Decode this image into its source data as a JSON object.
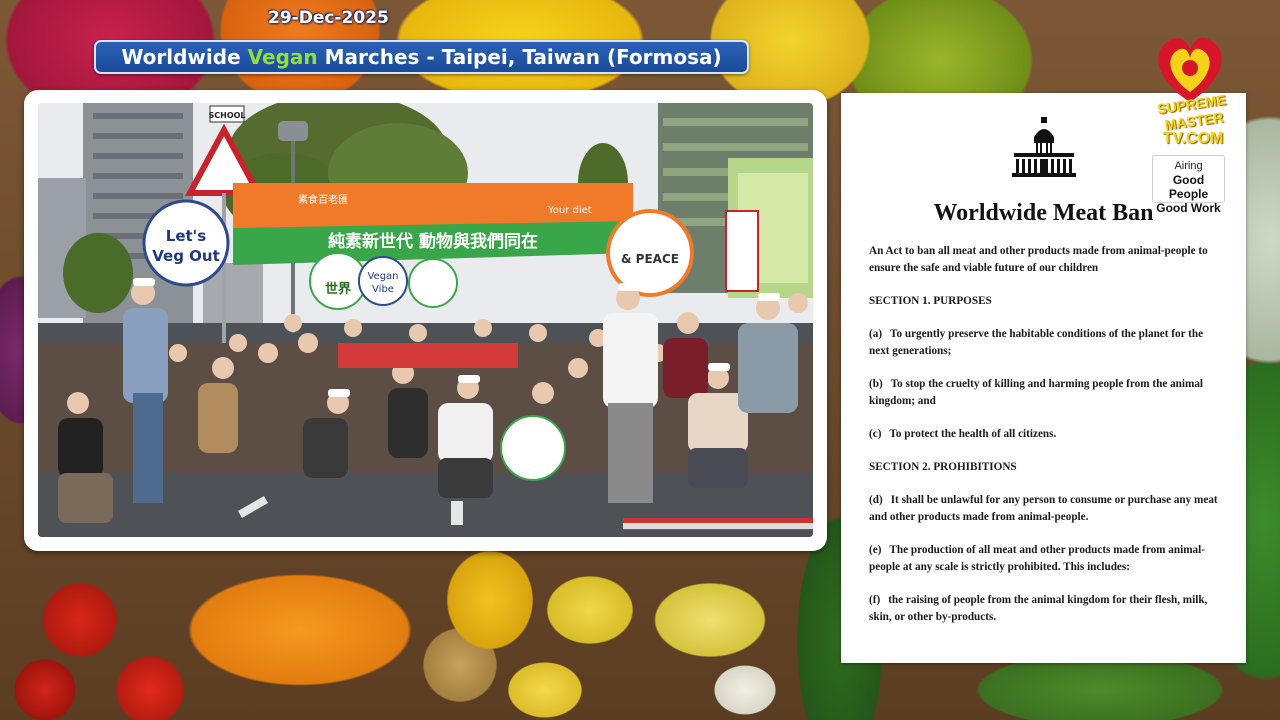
{
  "header": {
    "date": "29-Dec-2025",
    "title_prefix": "Worldwide ",
    "title_accent": "Vegan",
    "title_suffix": " Marches - Taipei, Taiwan (Formosa)"
  },
  "photo": {
    "signs": {
      "school": "SCHOOL",
      "lets_veg_out_1": "Let's",
      "lets_veg_out_2": "Veg Out",
      "banner_main": "純素新世代 動物與我們同在",
      "banner_small": "素食百老匯",
      "vegan_vibe_1": "Vegan",
      "vegan_vibe_2": "Vibe",
      "peace": "& PEACE",
      "your_diet": "Your diet",
      "world_sign": "世界"
    }
  },
  "logo": {
    "line1": "SUPREME MASTER",
    "line2": "TV.COM",
    "colors": {
      "red": "#d8162a",
      "gold": "#f7d21a"
    }
  },
  "document": {
    "airing_label": "Airing",
    "airing_line1": "Good People",
    "airing_line2": "Good Work",
    "title": "Worldwide Meat Ban",
    "intro": "An Act to ban all meat and other products made from animal-people to ensure the safe and viable future of our children",
    "section1": "SECTION 1. PURPOSES",
    "items1": [
      {
        "label": "(a)",
        "text": "To urgently preserve the habitable conditions of the planet for the next generations;"
      },
      {
        "label": "(b)",
        "text": "To stop the cruelty of killing and harming people from the animal kingdom; and"
      },
      {
        "label": "(c)",
        "text": "To protect the health of all citizens."
      }
    ],
    "section2": "SECTION 2. PROHIBITIONS",
    "items2": [
      {
        "label": "(d)",
        "text": "It shall be unlawful for any person to consume or purchase any meat and other products made from animal-people."
      },
      {
        "label": "(e)",
        "text": "The production of all meat and other products made from animal-people at any scale is strictly prohibited. This includes:"
      },
      {
        "label": "(f)",
        "text": "the raising of people from the animal kingdom for their flesh, milk, skin, or other by-products."
      }
    ]
  },
  "colors": {
    "title_bar": "#1b4a98",
    "title_accent": "#8fe03a",
    "banner_orange": "#f07a2a",
    "banner_green": "#3aa64a"
  }
}
